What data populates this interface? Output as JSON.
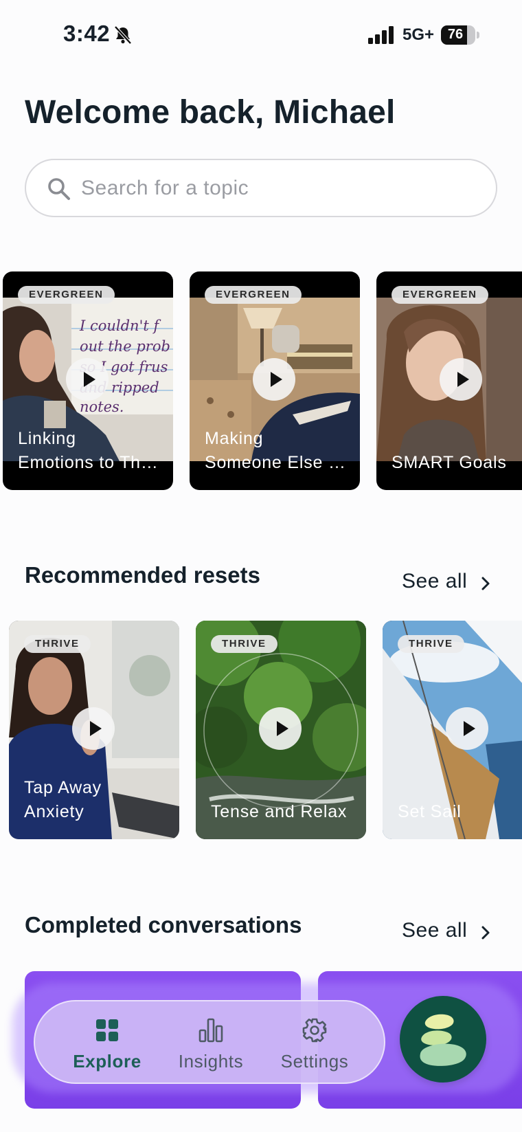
{
  "status_bar": {
    "time": "3:42",
    "network": "5G+",
    "battery_level": "76",
    "icons": [
      "bell-slash-icon",
      "signal-icon",
      "battery-icon"
    ]
  },
  "header": {
    "title": "Welcome back, Michael"
  },
  "search": {
    "placeholder": "Search for a topic",
    "icon": "search-icon"
  },
  "featured_videos": [
    {
      "tag": "EVERGREEN",
      "title": "Linking\nEmotions to Th…"
    },
    {
      "tag": "EVERGREEN",
      "title": "Making\nSomeone Else …"
    },
    {
      "tag": "EVERGREEN",
      "title": "SMART Goals"
    }
  ],
  "recommended_resets": {
    "title": "Recommended resets",
    "see_all": "See all",
    "items": [
      {
        "tag": "THRIVE",
        "title": "Tap Away\nAnxiety"
      },
      {
        "tag": "THRIVE",
        "title": "Tense and Relax"
      },
      {
        "tag": "THRIVE",
        "title": "Set Sail"
      }
    ]
  },
  "completed_conversations": {
    "title": "Completed conversations",
    "see_all": "See all"
  },
  "bottom_nav": {
    "items": [
      {
        "label": "Explore",
        "icon": "grid-icon",
        "active": true
      },
      {
        "label": "Insights",
        "icon": "bar-chart-icon",
        "active": false
      },
      {
        "label": "Settings",
        "icon": "gear-icon",
        "active": false
      }
    ],
    "fab_icon": "leaf-logo-icon"
  },
  "colors": {
    "accent_green": "#1d5f57",
    "fab_green": "#0f5142",
    "conversation_purple": "#8a4ff0"
  }
}
